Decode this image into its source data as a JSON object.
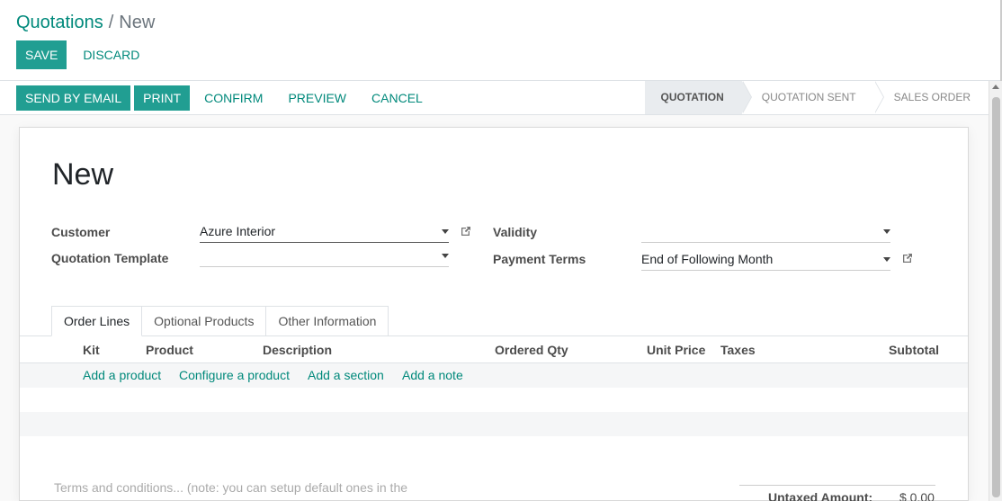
{
  "breadcrumb": {
    "parent": "Quotations",
    "separator": "/",
    "current": "New"
  },
  "control_buttons": {
    "save": "SAVE",
    "discard": "DISCARD"
  },
  "status_buttons": {
    "send_email": "SEND BY EMAIL",
    "print": "PRINT",
    "confirm": "CONFIRM",
    "preview": "PREVIEW",
    "cancel": "CANCEL"
  },
  "status_steps": [
    {
      "label": "QUOTATION",
      "active": true
    },
    {
      "label": "QUOTATION SENT",
      "active": false
    },
    {
      "label": "SALES ORDER",
      "active": false
    }
  ],
  "form": {
    "title": "New",
    "customer": {
      "label": "Customer",
      "value": "Azure Interior"
    },
    "quotation_template": {
      "label": "Quotation Template",
      "value": ""
    },
    "validity": {
      "label": "Validity",
      "value": ""
    },
    "payment_terms": {
      "label": "Payment Terms",
      "value": "End of Following Month"
    }
  },
  "tabs": [
    {
      "label": "Order Lines",
      "active": true
    },
    {
      "label": "Optional Products",
      "active": false
    },
    {
      "label": "Other Information",
      "active": false
    }
  ],
  "table": {
    "columns": {
      "kit": "Kit",
      "product": "Product",
      "description": "Description",
      "ordered_qty": "Ordered Qty",
      "unit_price": "Unit Price",
      "taxes": "Taxes",
      "subtotal": "Subtotal"
    },
    "add_links": {
      "add_product": "Add a product",
      "configure_product": "Configure a product",
      "add_section": "Add a section",
      "add_note": "Add a note"
    }
  },
  "terms_placeholder": "Terms and conditions... (note: you can setup default ones in the Configuration menu)",
  "totals": {
    "untaxed_label": "Untaxed Amount:",
    "untaxed_value": "$ 0.00"
  },
  "colors": {
    "accent": "#00897b",
    "primary_button": "#219e92",
    "active_step": "#e9ecef"
  }
}
